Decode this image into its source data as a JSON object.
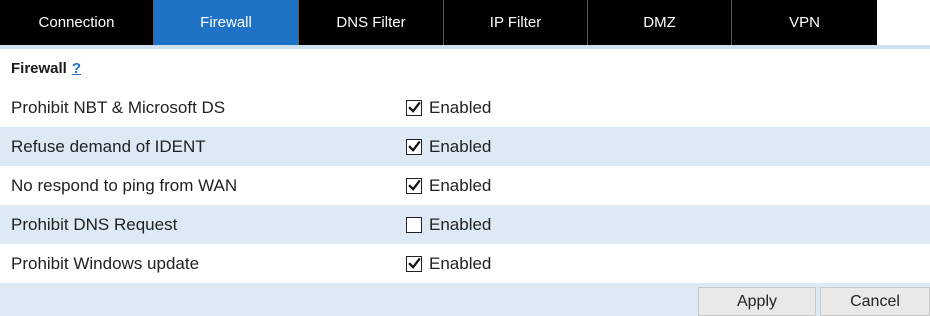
{
  "tabs": [
    {
      "label": "Connection",
      "active": false
    },
    {
      "label": "Firewall",
      "active": true
    },
    {
      "label": "DNS Filter",
      "active": false
    },
    {
      "label": "IP Filter",
      "active": false
    },
    {
      "label": "DMZ",
      "active": false
    },
    {
      "label": "VPN",
      "active": false
    }
  ],
  "section": {
    "title": "Firewall",
    "help": "?"
  },
  "settings": [
    {
      "label": "Prohibit NBT & Microsoft DS",
      "checked": true,
      "option": "Enabled"
    },
    {
      "label": "Refuse demand of IDENT",
      "checked": true,
      "option": "Enabled"
    },
    {
      "label": "No respond to ping from WAN",
      "checked": true,
      "option": "Enabled"
    },
    {
      "label": "Prohibit DNS Request",
      "checked": false,
      "option": "Enabled"
    },
    {
      "label": "Prohibit Windows update",
      "checked": true,
      "option": "Enabled"
    }
  ],
  "buttons": {
    "apply": "Apply",
    "cancel": "Cancel"
  },
  "colors": {
    "tab_bg": "#000000",
    "tab_active": "#1f73c6",
    "row_alt": "#dde9f5",
    "link": "#1f73c6"
  }
}
